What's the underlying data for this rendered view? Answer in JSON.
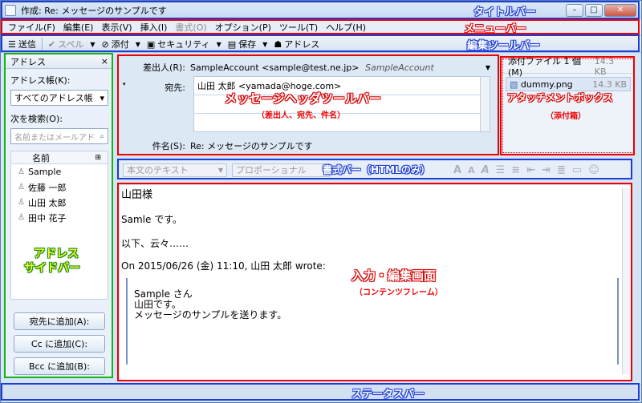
{
  "window": {
    "title": "作成: Re: メッセージのサンプルです",
    "buttons": {
      "minimize": "–",
      "maximize": "□",
      "close": "✕"
    }
  },
  "menubar": {
    "items": [
      {
        "label": "ファイル(F)",
        "enabled": true
      },
      {
        "label": "編集(E)",
        "enabled": true
      },
      {
        "label": "表示(V)",
        "enabled": true
      },
      {
        "label": "挿入(I)",
        "enabled": true
      },
      {
        "label": "書式(O)",
        "enabled": false
      },
      {
        "label": "オプション(P)",
        "enabled": true
      },
      {
        "label": "ツール(T)",
        "enabled": true
      },
      {
        "label": "ヘルプ(H)",
        "enabled": true
      }
    ]
  },
  "toolbar": {
    "send": "送信",
    "spell": "スペル",
    "attach": "添付",
    "security": "セキュリティ",
    "save": "保存",
    "address": "アドレス"
  },
  "sidebar": {
    "title": "アドレス",
    "close": "×",
    "addressbook_label": "アドレス帳(K):",
    "addressbook_value": "すべてのアドレス帳",
    "search_label": "次を検索(O):",
    "search_placeholder": "名前またはメールアド",
    "column_name": "名前",
    "contacts": [
      "Sample",
      "佐藤 一郎",
      "山田 太郎",
      "田中 花子"
    ],
    "add_to": "宛先に追加(A):",
    "add_cc": "Cc に追加(C):",
    "add_bcc": "Bcc に追加(B):"
  },
  "header": {
    "from_label": "差出人(R):",
    "from_value": "SampleAccount <sample@test.ne.jp>",
    "from_account": "SampleAccount",
    "to_label": "宛先:",
    "to_value": "山田 太郎 <yamada@hoge.com>",
    "subject_label": "件名(S):",
    "subject_value": "Re: メッセージのサンプルです"
  },
  "attachments": {
    "header": "添付ファイル 1 個(M)",
    "total_size": "14.3 KB",
    "items": [
      {
        "name": "dummy.png",
        "size": "14.3 KB"
      }
    ]
  },
  "formatbar": {
    "paragraph": "本文のテキスト",
    "font": "プロポーショナル"
  },
  "content": {
    "line1": "山田様",
    "line2": "Samle です。",
    "line3": "以下、云々……",
    "line4": "On 2015/06/26 (金) 11:10, 山田 太郎 wrote:",
    "quote1": "Sample さん",
    "quote2": "山田です。",
    "quote3": "メッセージのサンプルを送ります。"
  },
  "annotations": {
    "titlebar": "タイトルバー",
    "menubar": "メニューバー",
    "edit_toolbar": "編集ツールバー",
    "header_toolbar": "メッセージヘッダツールバー",
    "header_sub": "（差出人、宛先、件名）",
    "attachment_box": "アタッチメントボックス",
    "attachment_sub": "（添付箱）",
    "format_bar": "書式バー（HTMLのみ）",
    "address_sidebar_1": "アドレス",
    "address_sidebar_2": "サイドバー",
    "content": "入力・編集画面",
    "content_sub": "（コンテンツフレーム）",
    "statusbar": "ステータスバー"
  }
}
